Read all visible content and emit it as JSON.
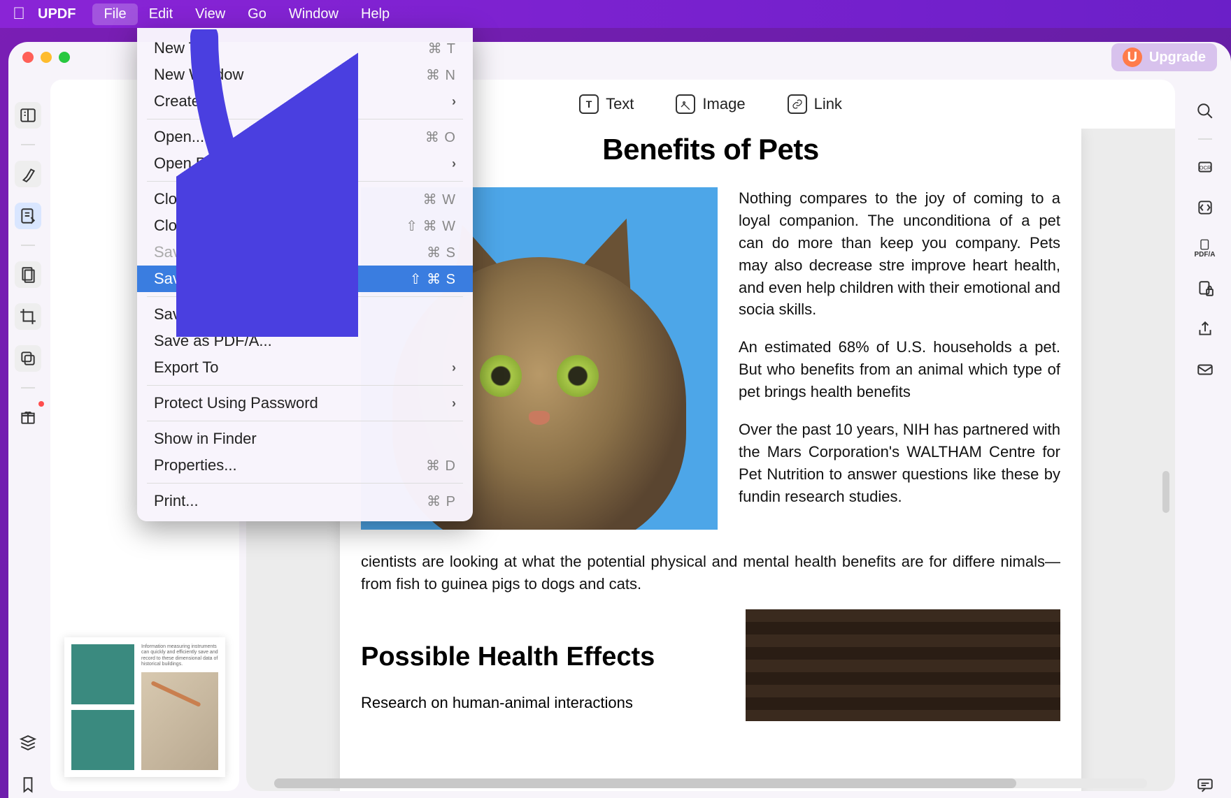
{
  "menubar": {
    "app": "UPDF",
    "items": [
      "File",
      "Edit",
      "View",
      "Go",
      "Window",
      "Help"
    ],
    "active": "File"
  },
  "upgrade": {
    "badge": "U",
    "label": "Upgrade"
  },
  "toolbar": {
    "text": "Text",
    "image": "Image",
    "link": "Link"
  },
  "dropdown": {
    "newTab": "New Tab",
    "newTabShort": "⌘ T",
    "newWindow": "New Window",
    "newWindowShort": "⌘ N",
    "create": "Create",
    "open": "Open...",
    "openShort": "⌘ O",
    "openRecent": "Open Recent",
    "closeTab": "Close Tab",
    "closeTabShort": "⌘ W",
    "closeWindow": "Close Window",
    "closeWindowShort": "⇧ ⌘ W",
    "save": "Save...",
    "saveShort": "⌘ S",
    "saveAs": "Save As...",
    "saveAsShort": "⇧ ⌘ S",
    "saveFlatten": "Save as Flatten...",
    "savePdfa": "Save as PDF/A...",
    "exportTo": "Export To",
    "protect": "Protect Using Password",
    "showFinder": "Show in Finder",
    "properties": "Properties...",
    "propertiesShort": "⌘ D",
    "print": "Print...",
    "printShort": "⌘ P"
  },
  "rightRail": {
    "pdfa": "PDF/A",
    "ocr": "OCR"
  },
  "document": {
    "title": "Benefits of Pets",
    "p1": "Nothing compares to the joy of coming to a loyal companion. The unconditiona of a pet can do more than keep you company. Pets may also decrease stre improve heart health, and even help children with their emotional and socia skills.",
    "p2": "An estimated 68% of U.S. households a pet. But who benefits from an animal which type of pet brings health benefits",
    "p3": "Over the past 10 years, NIH has partnered with the Mars Corporation's WALTHAM Centre for Pet Nutrition to answer questions like these by fundin research studies.",
    "p4": "cientists are looking at what the potential physical and mental health benefits are for differe nimals—from fish to guinea pigs to dogs and cats.",
    "h2": "Possible Health Effects",
    "p5": "Research on human-animal interactions"
  }
}
